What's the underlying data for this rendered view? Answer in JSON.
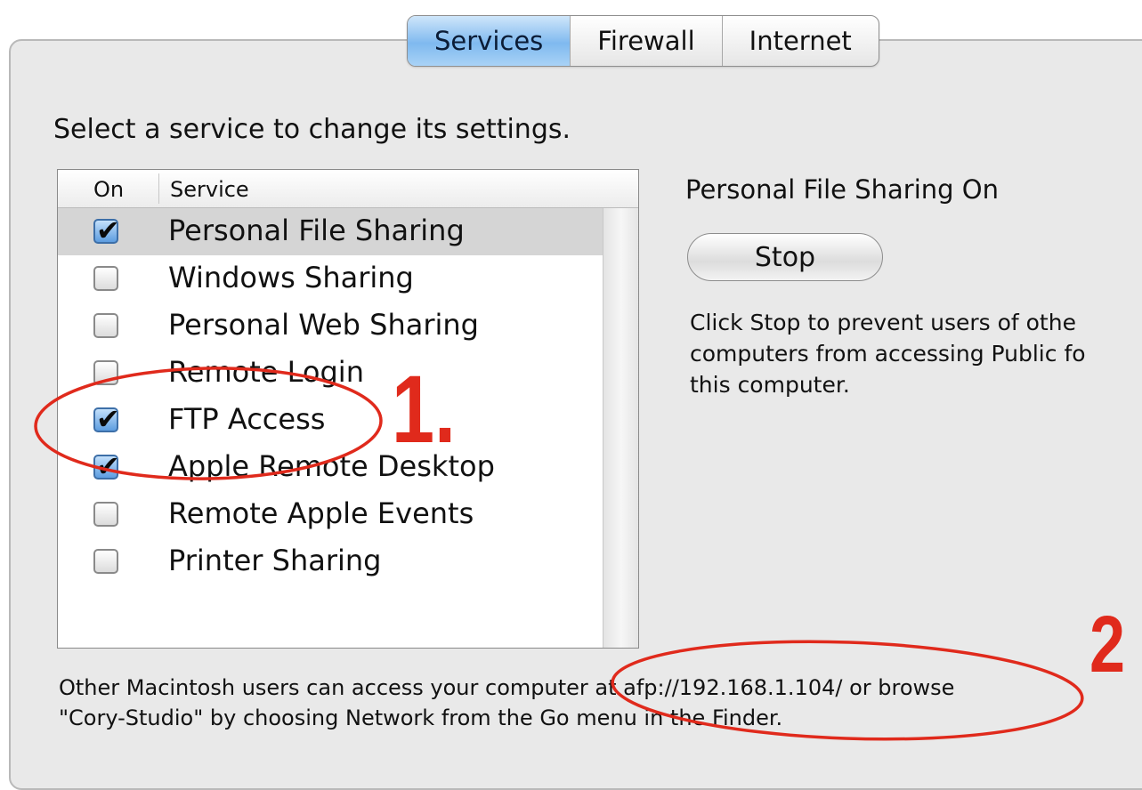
{
  "tabs": [
    {
      "label": "Services",
      "active": true
    },
    {
      "label": "Firewall",
      "active": false
    },
    {
      "label": "Internet",
      "active": false
    }
  ],
  "instructions": "Select a service to change its settings.",
  "list": {
    "columns": {
      "on": "On",
      "service": "Service"
    },
    "rows": [
      {
        "label": "Personal File Sharing",
        "checked": true,
        "selected": true
      },
      {
        "label": "Windows Sharing",
        "checked": false,
        "selected": false
      },
      {
        "label": "Personal Web Sharing",
        "checked": false,
        "selected": false
      },
      {
        "label": "Remote Login",
        "checked": false,
        "selected": false
      },
      {
        "label": "FTP Access",
        "checked": true,
        "selected": false
      },
      {
        "label": "Apple Remote Desktop",
        "checked": true,
        "selected": false
      },
      {
        "label": "Remote Apple Events",
        "checked": false,
        "selected": false
      },
      {
        "label": "Printer Sharing",
        "checked": false,
        "selected": false
      }
    ]
  },
  "detail": {
    "status": "Personal File Sharing On",
    "button": "Stop",
    "description_lines": [
      "Click Stop to prevent users of othe",
      "computers from accessing Public fo",
      "this computer."
    ]
  },
  "footer_lines": [
    "Other Macintosh users can access your computer at afp://192.168.1.104/ or browse",
    "\"Cory-Studio\" by choosing Network from the Go menu in the Finder."
  ],
  "annotations": {
    "one": "1.",
    "two": "2"
  },
  "colors": {
    "annotation": "#e02a1c",
    "tab_active": "#7fb9ef"
  }
}
